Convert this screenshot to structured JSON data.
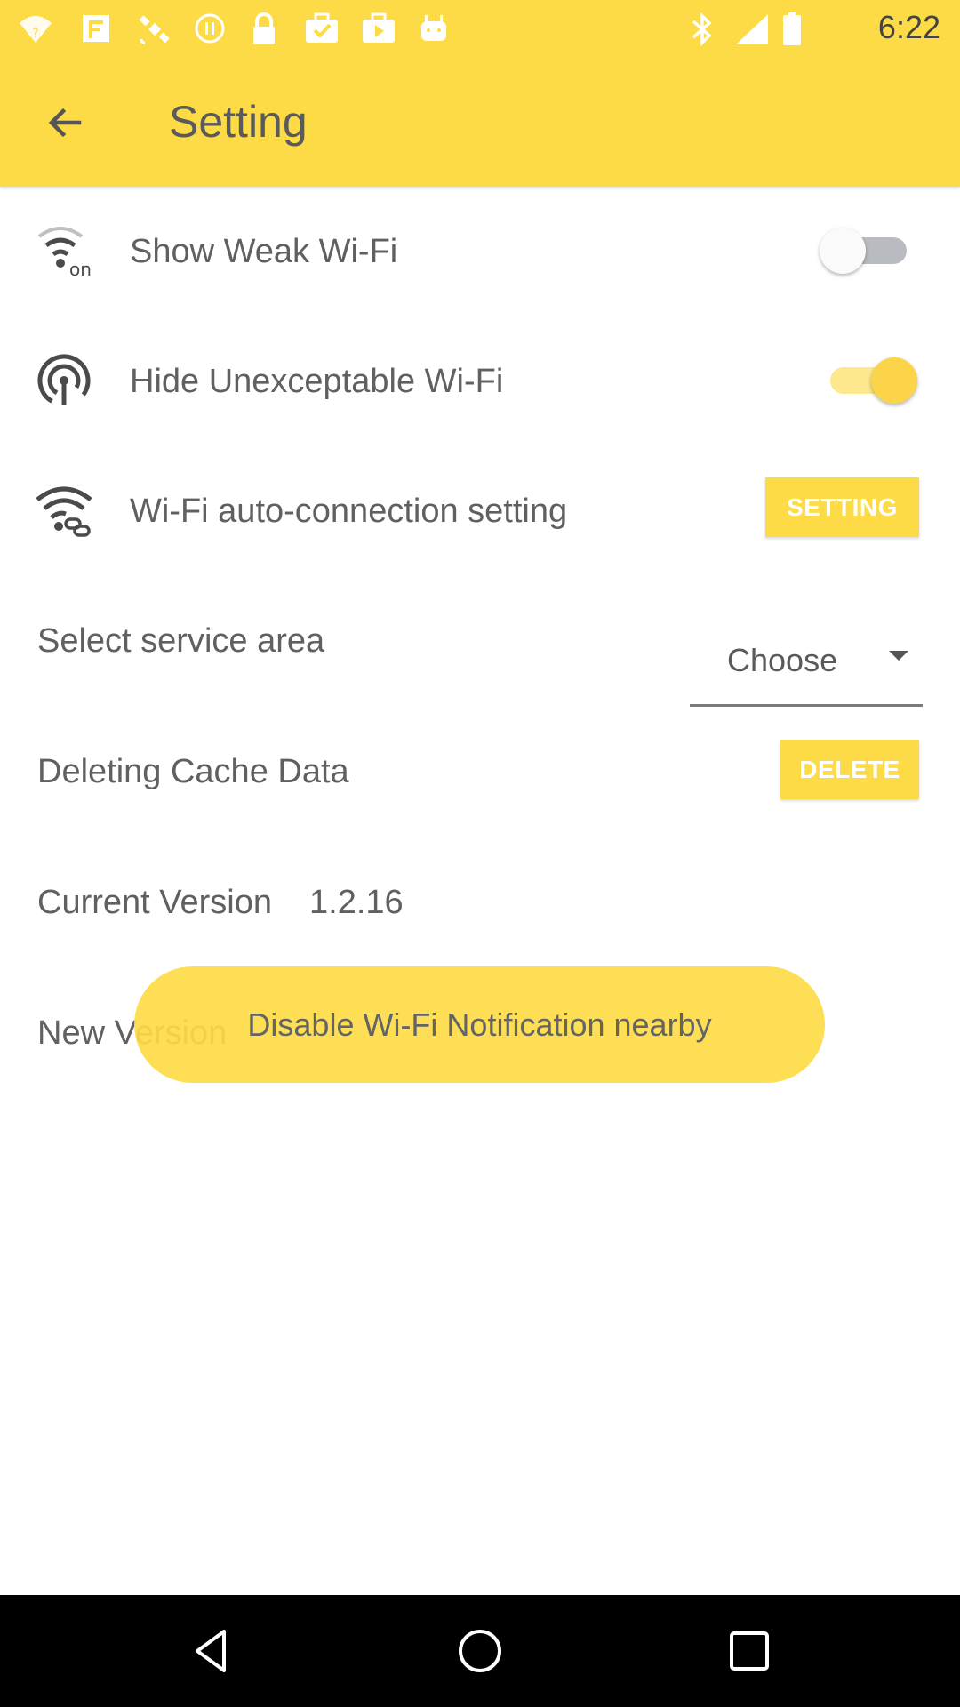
{
  "status_bar": {
    "time": "6:22",
    "icons": [
      "wifi-question-icon",
      "fake-gps-icon",
      "satellite-icon",
      "circle-pause-icon",
      "lock-icon",
      "bag-check-icon",
      "play-store-icon",
      "android-icon",
      "bluetooth-icon",
      "signal-icon",
      "battery-icon"
    ]
  },
  "app_bar": {
    "title": "Setting",
    "back_icon": "arrow-back-icon"
  },
  "settings": {
    "show_weak_wifi": {
      "label": "Show Weak Wi-Fi",
      "icon": "wifi-on-icon",
      "enabled": false
    },
    "hide_unexceptable_wifi": {
      "label": "Hide Unexceptable Wi-Fi",
      "icon": "hotspot-icon",
      "enabled": true
    },
    "wifi_auto_connection": {
      "label": "Wi-Fi auto-connection setting",
      "icon": "wifi-link-icon",
      "button_label": "SETTING"
    },
    "service_area": {
      "label": "Select service area",
      "selected": "Choose"
    },
    "cache": {
      "label": "Deleting Cache Data",
      "button_label": "DELETE"
    },
    "current_version": {
      "label": "Current Version",
      "value": "1.2.16"
    },
    "new_version": {
      "label": "New Version"
    }
  },
  "toast": {
    "text": "Disable Wi-Fi Notification nearby"
  },
  "colors": {
    "accent": "#fddb46",
    "text": "#606060",
    "toggle_on": "#fcd44a",
    "toggle_off_track": "#b8bcc0"
  },
  "nav_bar": {
    "back": "nav-back-icon",
    "home": "nav-home-icon",
    "recents": "nav-recents-icon"
  }
}
